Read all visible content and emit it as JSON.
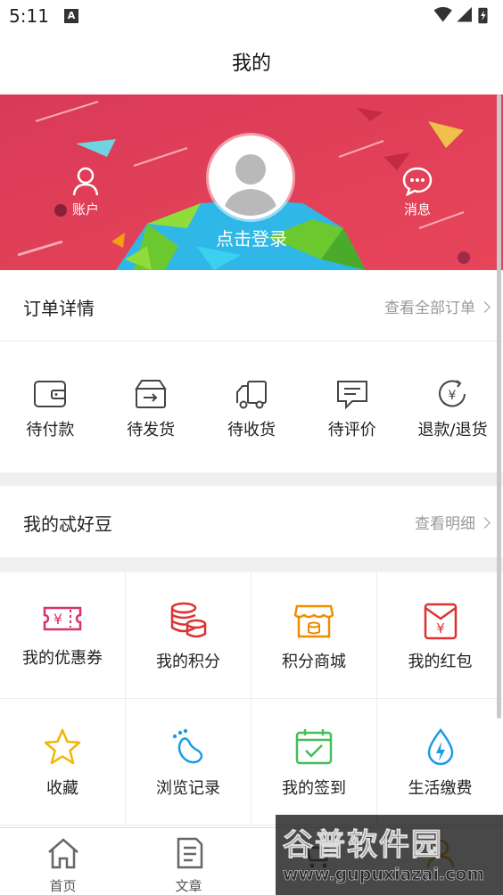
{
  "status_bar": {
    "time": "5:11",
    "notification_badge": "A"
  },
  "header": {
    "title": "我的"
  },
  "profile": {
    "account_label": "账户",
    "messages_label": "消息",
    "login_prompt": "点击登录"
  },
  "orders": {
    "title": "订单详情",
    "view_all": "查看全部订单",
    "items": [
      {
        "label": "待付款",
        "icon": "wallet-icon"
      },
      {
        "label": "待发货",
        "icon": "box-icon"
      },
      {
        "label": "待收货",
        "icon": "truck-icon"
      },
      {
        "label": "待评价",
        "icon": "comment-icon"
      },
      {
        "label": "退款/退货",
        "icon": "refund-icon"
      }
    ]
  },
  "beans": {
    "title": "我的忒好豆",
    "detail": "查看明细"
  },
  "services": [
    {
      "label": "我的优惠券",
      "icon": "coupon-icon",
      "color": "#d6336c"
    },
    {
      "label": "我的积分",
      "icon": "coins-icon",
      "color": "#e03131"
    },
    {
      "label": "积分商城",
      "icon": "shop-icon",
      "color": "#f08c00"
    },
    {
      "label": "我的红包",
      "icon": "red-envelope-icon",
      "color": "#e03131"
    },
    {
      "label": "收藏",
      "icon": "star-icon",
      "color": "#f2b600"
    },
    {
      "label": "浏览记录",
      "icon": "footprint-icon",
      "color": "#1c9be6"
    },
    {
      "label": "我的签到",
      "icon": "checkin-calendar-icon",
      "color": "#40c057"
    },
    {
      "label": "生活缴费",
      "icon": "water-drop-icon",
      "color": "#1c9be6"
    }
  ],
  "tabbar": [
    {
      "label": "首页",
      "icon": "home-icon"
    },
    {
      "label": "文章",
      "icon": "article-icon"
    },
    {
      "label": "",
      "icon": "cart-icon"
    },
    {
      "label": "",
      "icon": "mine-icon"
    }
  ],
  "watermark": {
    "title": "谷普软件园",
    "url": "www.gupuxiazai.com"
  },
  "colors": {
    "banner": "#e13a55",
    "divider": "#f0f0f0",
    "muted_text": "#999999"
  }
}
